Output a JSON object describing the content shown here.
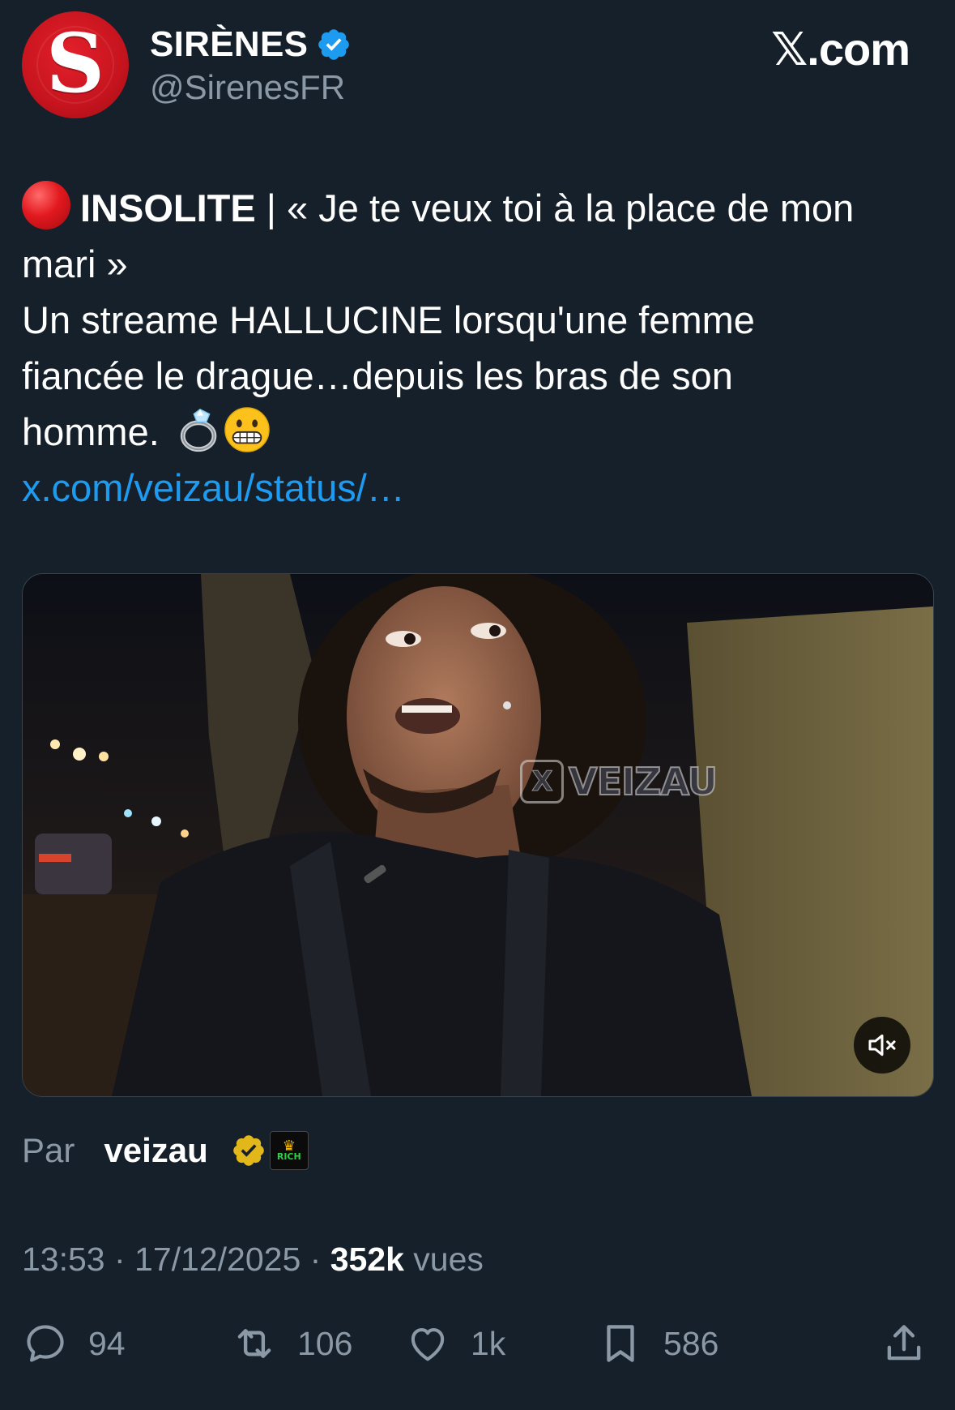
{
  "header": {
    "avatar_letter": "S",
    "display_name": "SIRÈNES",
    "handle": "@SirenesFR",
    "brand": "𝕏.com",
    "verified_icon": "verified-badge-icon"
  },
  "tweet": {
    "line1_tag": "INSOLITE",
    "line1_rest": " | « Je te veux toi à la place de mon",
    "line2": "mari »",
    "line3": "Un streame HALLUCINE lorsqu'une femme",
    "line4": "fiancée le drague…depuis les bras de son",
    "line5": "homme.",
    "link": "x.com/veizau/status/…",
    "icons": [
      "red-circle-icon",
      "ring-icon",
      "grimacing-face-icon"
    ]
  },
  "media": {
    "watermark_text": "VEIZAU",
    "watermark_x": "X",
    "mute_icon": "muted-speaker-icon"
  },
  "attribution": {
    "prefix": "Par",
    "author": "veizau",
    "rich_badge_text": "RICH"
  },
  "meta": {
    "time": "13:53",
    "sep1": " · ",
    "date": "17/12/2025",
    "sep2": " · ",
    "views_count": "352k",
    "views_label": " vues"
  },
  "actions": {
    "replies": "94",
    "reposts": "106",
    "likes": "1k",
    "bookmarks": "586"
  },
  "colors": {
    "background": "#15202b",
    "secondary_text": "#8b98a5",
    "link": "#1d9bf0",
    "verified": "#1d9bf0",
    "avatar_red": "#c6141e"
  }
}
